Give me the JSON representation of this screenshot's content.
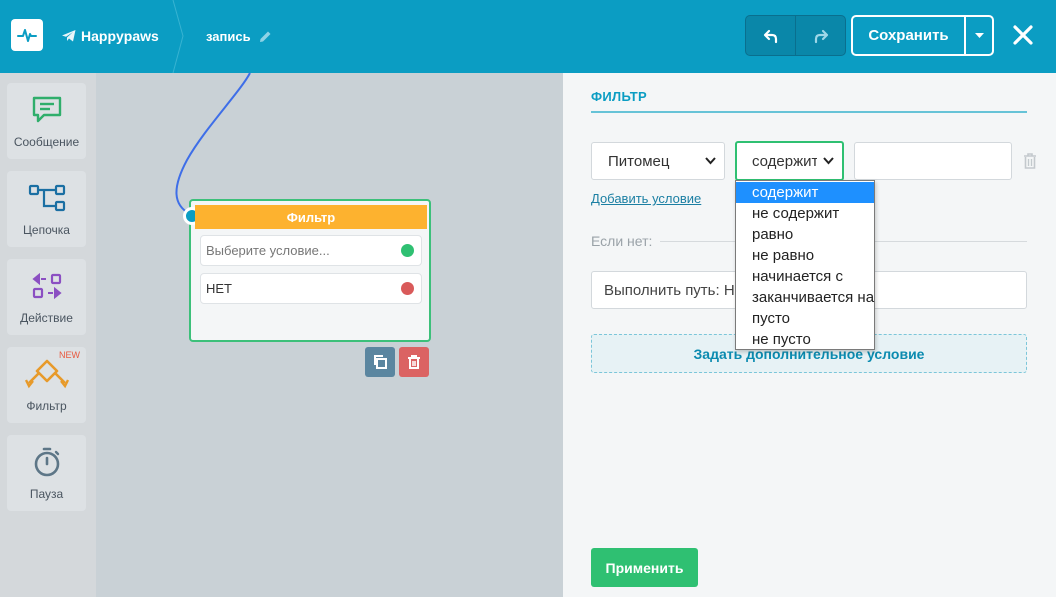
{
  "header": {
    "brand": "Happypaws",
    "title": "запись",
    "save_label": "Сохранить"
  },
  "sidebar": {
    "items": [
      {
        "label": "Сообщение",
        "icon": "message-icon"
      },
      {
        "label": "Цепочка",
        "icon": "chain-icon"
      },
      {
        "label": "Действие",
        "icon": "action-icon"
      },
      {
        "label": "Фильтр",
        "icon": "filter-icon",
        "badge": "NEW"
      },
      {
        "label": "Пауза",
        "icon": "timer-icon"
      }
    ]
  },
  "node": {
    "title": "Фильтр",
    "rows": [
      "Выберите условие...",
      "НЕТ"
    ]
  },
  "panel": {
    "title": "ФИЛЬТР",
    "field_select": "Питомец",
    "operator_select": "содержит",
    "add_condition": "Добавить условие",
    "else_label": "Если нет:",
    "path_value": "Выполнить путь: НЕТ",
    "extra_condition": "Задать дополнительное условие",
    "apply": "Применить"
  },
  "dropdown": {
    "options": [
      "содержит",
      "не содержит",
      "равно",
      "не равно",
      "начинается с",
      "заканчивается на",
      "пусто",
      "не пусто"
    ],
    "selected": "содержит"
  },
  "colors": {
    "header": "#0b9dc3",
    "node_head": "#fdb22f",
    "apply": "#2fc072",
    "connector": "#3e6ee8"
  }
}
